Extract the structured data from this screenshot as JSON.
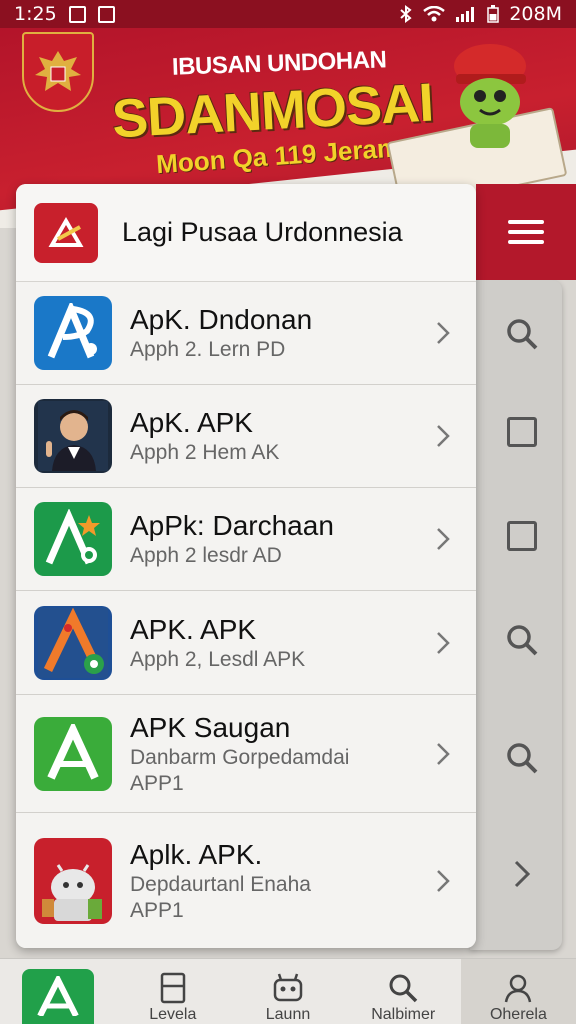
{
  "status": {
    "time": "1:25",
    "battery": "208M"
  },
  "banner": {
    "line1": "IBUSAN UNDOHAN",
    "line2": "SDANMOSAI",
    "line3": "Moon Qa 119 Jeramel"
  },
  "header": {
    "title": "Lagi Pusaa Urdonnesia"
  },
  "items": [
    {
      "title": "ApK. Dndonan",
      "subtitle": "Apph 2. Lern PD",
      "subtitle2": ""
    },
    {
      "title": "ApK. APK",
      "subtitle": "Apph 2 Hem AK",
      "subtitle2": ""
    },
    {
      "title": "ApPk: Darchaan",
      "subtitle": "Apph 2 lesdr AD",
      "subtitle2": ""
    },
    {
      "title": "APK. APK",
      "subtitle": "Apph 2, Lesdl APK",
      "subtitle2": ""
    },
    {
      "title": "APK Saugan",
      "subtitle": "Danbarm Gorpedamdai",
      "subtitle2": "APP1"
    },
    {
      "title": "Aplk. APK.",
      "subtitle": "Depdaurtanl Enaha",
      "subtitle2": "APP1"
    }
  ],
  "nav": {
    "item1": "Levela",
    "item2": "Launn",
    "item3": "Nalbimer",
    "item4": "Oherela"
  },
  "colors": {
    "brand_red": "#b3182b",
    "accent_green": "#21a04a"
  },
  "icons": [
    "bluetooth-icon",
    "wifi-icon",
    "signal-icon",
    "battery-icon",
    "menu-icon",
    "search-icon",
    "square-icon",
    "chevron-right-icon",
    "home-icon",
    "bookmark-icon",
    "robot-icon",
    "profile-icon"
  ]
}
